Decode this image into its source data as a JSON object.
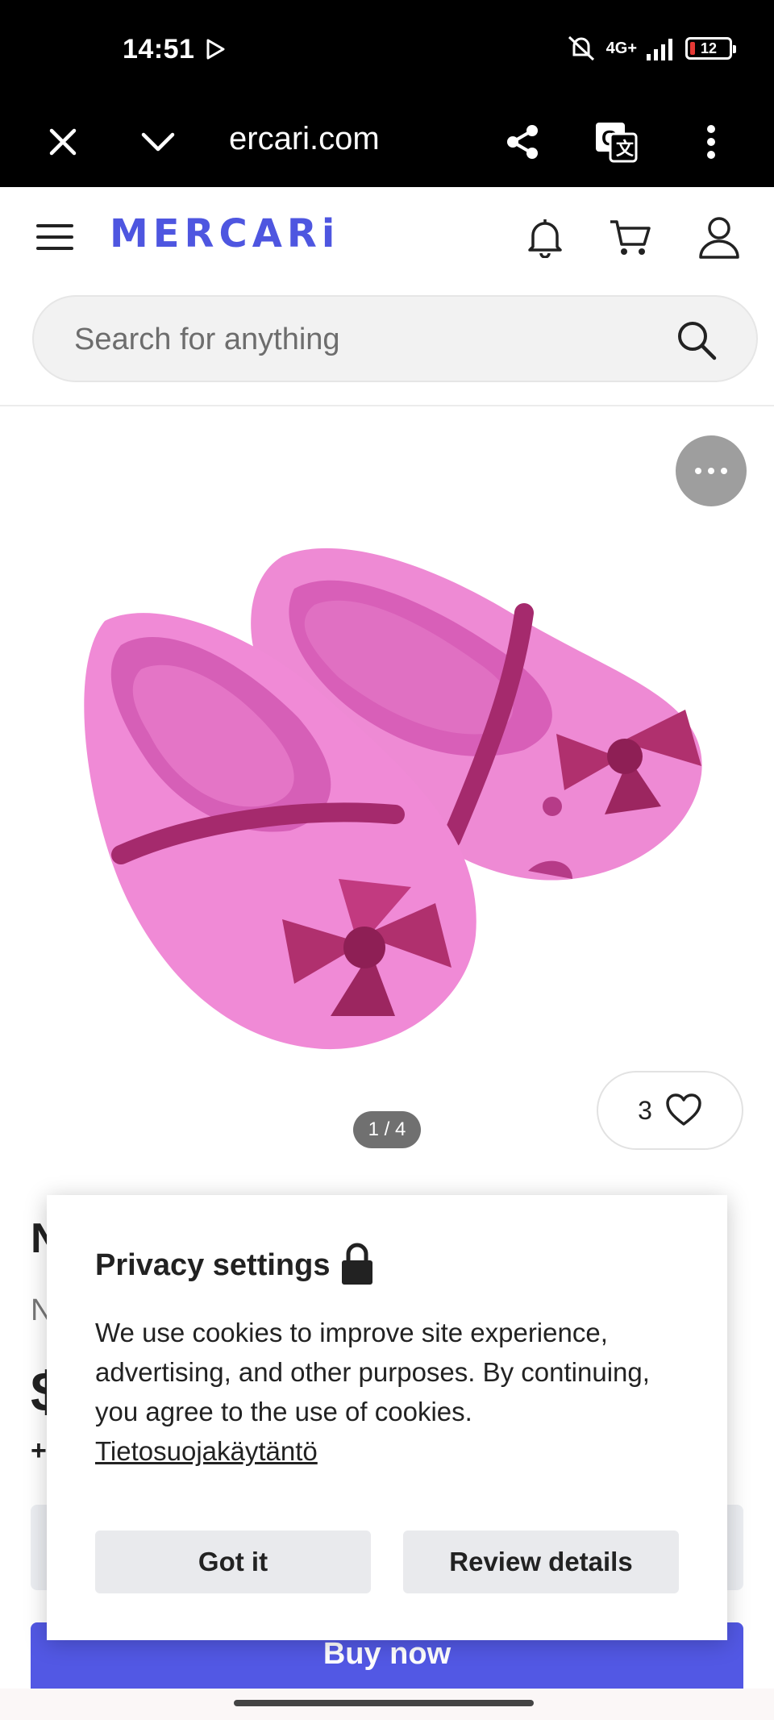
{
  "status_bar": {
    "time": "14:51",
    "network": "4G+",
    "battery": "12",
    "icons": [
      "play-store-icon",
      "mute-icon",
      "signal-icon",
      "battery-icon"
    ]
  },
  "browser": {
    "url": "ercari.com",
    "icons": [
      "close-icon",
      "chevron-down-icon",
      "share-icon",
      "translate-icon",
      "more-vertical-icon"
    ]
  },
  "header": {
    "logo": "MERCARi",
    "icons": [
      "menu-icon",
      "bell-icon",
      "cart-icon",
      "user-icon"
    ]
  },
  "search": {
    "placeholder": "Search for anything"
  },
  "product": {
    "image_pager": "1 / 4",
    "like_count": "3",
    "peek_title": "N",
    "peek_sub": "N",
    "peek_price": "$",
    "peek_plus": "+"
  },
  "privacy": {
    "title": "Privacy settings",
    "body": "We use cookies to improve site experience, advertising, and other purposes. By continuing, you agree to the use of cookies. ",
    "link": "Tietosuojakäytäntö",
    "got_it": "Got it",
    "review_details": "Review details"
  },
  "buy_now": "Buy now",
  "colors": {
    "brand": "#4e56e0",
    "buy_button": "#5258e4",
    "shoe_pink": "#f08ad6",
    "bow_magenta": "#b0306e"
  }
}
